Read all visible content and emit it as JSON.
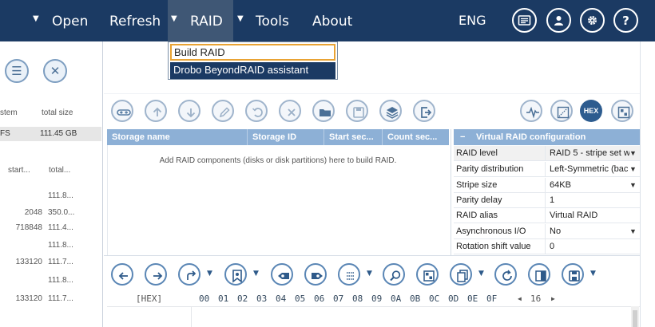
{
  "menu": {
    "items": [
      {
        "label": "Open",
        "has_arrow": true
      },
      {
        "label": "Refresh",
        "has_arrow": false
      },
      {
        "label": "RAID",
        "has_arrow": true,
        "active": true
      },
      {
        "label": "Tools",
        "has_arrow": true
      },
      {
        "label": "About",
        "has_arrow": false
      }
    ],
    "language": "ENG",
    "right_icons": [
      "messages-icon",
      "user-icon",
      "settings-icon",
      "help-icon"
    ],
    "colors": {
      "bar": "#1b3a63",
      "active": "#3f5775",
      "hover_border": "#e9a334"
    }
  },
  "raid_dropdown": {
    "items": [
      "Build RAID",
      "Drobo BeyondRAID assistant"
    ]
  },
  "left_panel": {
    "header1": [
      "stem",
      "total size"
    ],
    "selected_row": [
      "FS",
      "111.45 GB"
    ],
    "header2": [
      "start...",
      "total..."
    ],
    "rows": [
      {
        "start": "",
        "total": "111.8..."
      },
      {
        "start": "2048",
        "total": "350.0..."
      },
      {
        "start": "718848",
        "total": "111.4..."
      },
      {
        "start": "",
        "total": "111.8..."
      },
      {
        "start": "133120",
        "total": "111.7..."
      },
      {
        "start": "",
        "total": "111.8..."
      },
      {
        "start": "133120",
        "total": "111.7..."
      }
    ]
  },
  "storage_table": {
    "columns": [
      "Storage name",
      "Storage ID",
      "Start sec...",
      "Count sec..."
    ],
    "empty_hint": "Add RAID components (disks or disk partitions) here to build RAID."
  },
  "raid_config": {
    "title": "Virtual RAID configuration",
    "collapse_symbol": "−",
    "rows": [
      {
        "name": "RAID level",
        "value": "RAID 5 - stripe set w",
        "dropdown": true,
        "selected": true
      },
      {
        "name": "Parity distribution",
        "value": "Left-Symmetric (bac",
        "dropdown": true
      },
      {
        "name": "Stripe size",
        "value": "64KB",
        "dropdown": true
      },
      {
        "name": "Parity delay",
        "value": "1",
        "dropdown": false
      },
      {
        "name": "RAID alias",
        "value": "Virtual RAID",
        "dropdown": false
      },
      {
        "name": "Asynchronous I/O",
        "value": "No",
        "dropdown": true
      },
      {
        "name": "Rotation shift value",
        "value": "0",
        "dropdown": false
      }
    ]
  },
  "hex_view": {
    "label": "[HEX]",
    "columns": [
      "00",
      "01",
      "02",
      "03",
      "04",
      "05",
      "06",
      "07",
      "08",
      "09",
      "0A",
      "0B",
      "0C",
      "0D",
      "0E",
      "0F"
    ],
    "bytes_per_row": "16"
  }
}
